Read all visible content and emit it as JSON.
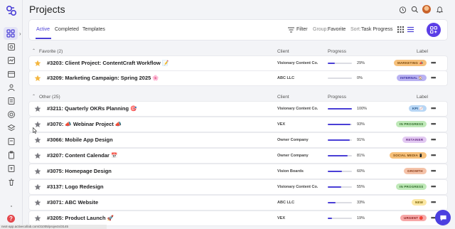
{
  "header": {
    "title": "Projects"
  },
  "toolbar": {
    "tabs": [
      {
        "label": "Active",
        "active": true
      },
      {
        "label": "Completed",
        "active": false
      },
      {
        "label": "Templates",
        "active": false
      }
    ],
    "filter_label": "Filter",
    "group_prefix": "Group:",
    "group_value": "Favorite",
    "sort_prefix": "Sort:",
    "sort_value": "Task Progress"
  },
  "columns": {
    "client": "Client",
    "progress": "Progress",
    "label": "Label"
  },
  "sections": [
    {
      "name": "Favorite (2)",
      "rows": [
        {
          "title": "#3203: Client Project: ContentCraft Workflow 📝",
          "client": "Visionary Content Co.",
          "progress": 0.29,
          "pct": "29%",
          "label": "MARKETING 📣",
          "label_bg": "#f6c07a",
          "label_fg": "#7a4a0f",
          "starred": true
        },
        {
          "title": "#3209: Marketing Campaign: Spring 2025 🌸",
          "client": "ABC LLC",
          "progress": 0.0,
          "pct": "0%",
          "label": "INTERNAL 🏠",
          "label_bg": "#b9b2f2",
          "label_fg": "#3b2fa0",
          "starred": true
        }
      ]
    },
    {
      "name": "Other (25)",
      "rows": [
        {
          "title": "#3211: Quarterly OKRs Planning 🎯",
          "client": "Visionary Content Co.",
          "progress": 1.0,
          "pct": "100%",
          "label": "KPI 📈",
          "label_bg": "#b7d6f5",
          "label_fg": "#1f4e84",
          "starred": false
        },
        {
          "title": "#3070: 📣 Webinar Project 📣",
          "client": "VEX",
          "progress": 0.93,
          "pct": "93%",
          "label": "IN PROGRESS",
          "label_bg": "#bfe9b8",
          "label_fg": "#2d6a26",
          "starred": false
        },
        {
          "title": "#3066: Mobile App Design",
          "client": "Owner Company",
          "progress": 0.91,
          "pct": "91%",
          "label": "RETAINER",
          "label_bg": "#e2c9f2",
          "label_fg": "#6a2e8a",
          "starred": false
        },
        {
          "title": "#3207: Content Calendar 📅",
          "client": "Owner Company",
          "progress": 0.81,
          "pct": "81%",
          "label": "SOCIAL MEDIA 📱",
          "label_bg": "#f6c07a",
          "label_fg": "#7a4a0f",
          "starred": false
        },
        {
          "title": "#3075: Homepage Design",
          "client": "Vision Boards",
          "progress": 0.6,
          "pct": "60%",
          "label": "GROWTH",
          "label_bg": "#f4c2a8",
          "label_fg": "#8a3b16",
          "starred": false
        },
        {
          "title": "#3137: Logo Redesign",
          "client": "Visionary Content Co.",
          "progress": 0.55,
          "pct": "55%",
          "label": "IN PROGRESS",
          "label_bg": "#bfe9b8",
          "label_fg": "#2d6a26",
          "starred": false
        },
        {
          "title": "#3071: ABC Website",
          "client": "ABC LLC",
          "progress": 0.33,
          "pct": "33%",
          "label": "NEW",
          "label_bg": "#fbe7a2",
          "label_fg": "#7a6207",
          "starred": false
        },
        {
          "title": "#3205: Product Launch 🚀",
          "client": "VEX",
          "progress": 0.19,
          "pct": "19%",
          "label": "URGENT 🔴",
          "label_bg": "#f7a8a8",
          "label_fg": "#8a1e1e",
          "starred": false
        }
      ]
    }
  ],
  "status_url": "next-app.activecollab.com/31005/projects/3145",
  "icons": {
    "sidebar": [
      "grid-icon",
      "inbox-icon",
      "activity-icon",
      "calendar-icon",
      "people-icon",
      "report-icon",
      "target-icon",
      "layers-icon",
      "stopwatch-icon",
      "clipboard-icon",
      "invoice-icon",
      "trash-icon"
    ],
    "header": [
      "timer-icon",
      "search-icon",
      "avatar",
      "bell-icon"
    ]
  }
}
